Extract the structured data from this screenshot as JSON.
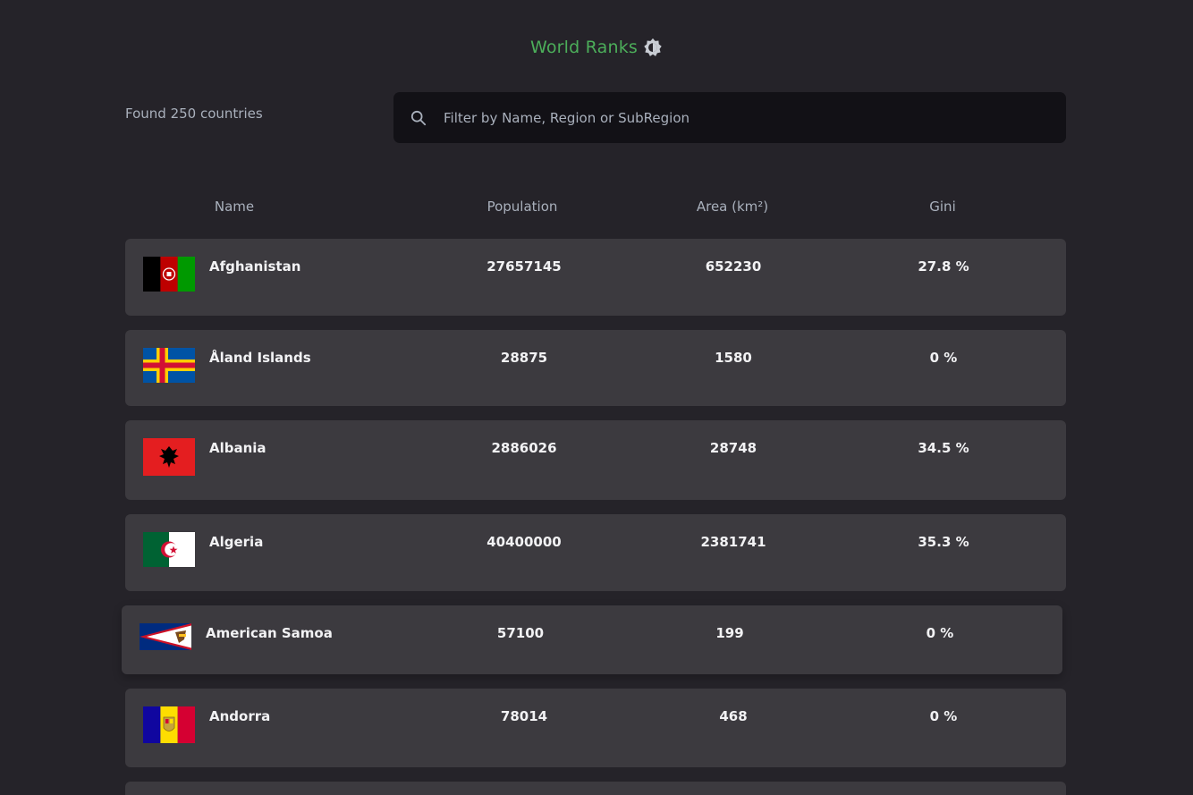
{
  "header": {
    "title": "World Ranks",
    "theme_icon": "theme-toggle-icon"
  },
  "toolbar": {
    "count_text": "Found 250 countries",
    "search": {
      "placeholder": "Filter by Name, Region or SubRegion",
      "value": ""
    }
  },
  "table": {
    "columns": [
      "Name",
      "Population",
      "Area (km²)",
      "Gini"
    ],
    "rows": [
      {
        "name": "Afghanistan",
        "population": "27657145",
        "area": "652230",
        "gini": "27.8 %",
        "flag_icon": "afghanistan-flag-icon"
      },
      {
        "name": "Åland Islands",
        "population": "28875",
        "area": "1580",
        "gini": "0 %",
        "flag_icon": "aland-islands-flag-icon"
      },
      {
        "name": "Albania",
        "population": "2886026",
        "area": "28748",
        "gini": "34.5 %",
        "flag_icon": "albania-flag-icon"
      },
      {
        "name": "Algeria",
        "population": "40400000",
        "area": "2381741",
        "gini": "35.3 %",
        "flag_icon": "algeria-flag-icon"
      },
      {
        "name": "American Samoa",
        "population": "57100",
        "area": "199",
        "gini": "0 %",
        "flag_icon": "american-samoa-flag-icon"
      },
      {
        "name": "Andorra",
        "population": "78014",
        "area": "468",
        "gini": "0 %",
        "flag_icon": "andorra-flag-icon"
      }
    ]
  },
  "colors": {
    "background": "#252329",
    "row_background": "#3c3a3f",
    "search_background": "#121116",
    "accent": "#4cae5a",
    "muted_text": "#a9b0bc"
  }
}
